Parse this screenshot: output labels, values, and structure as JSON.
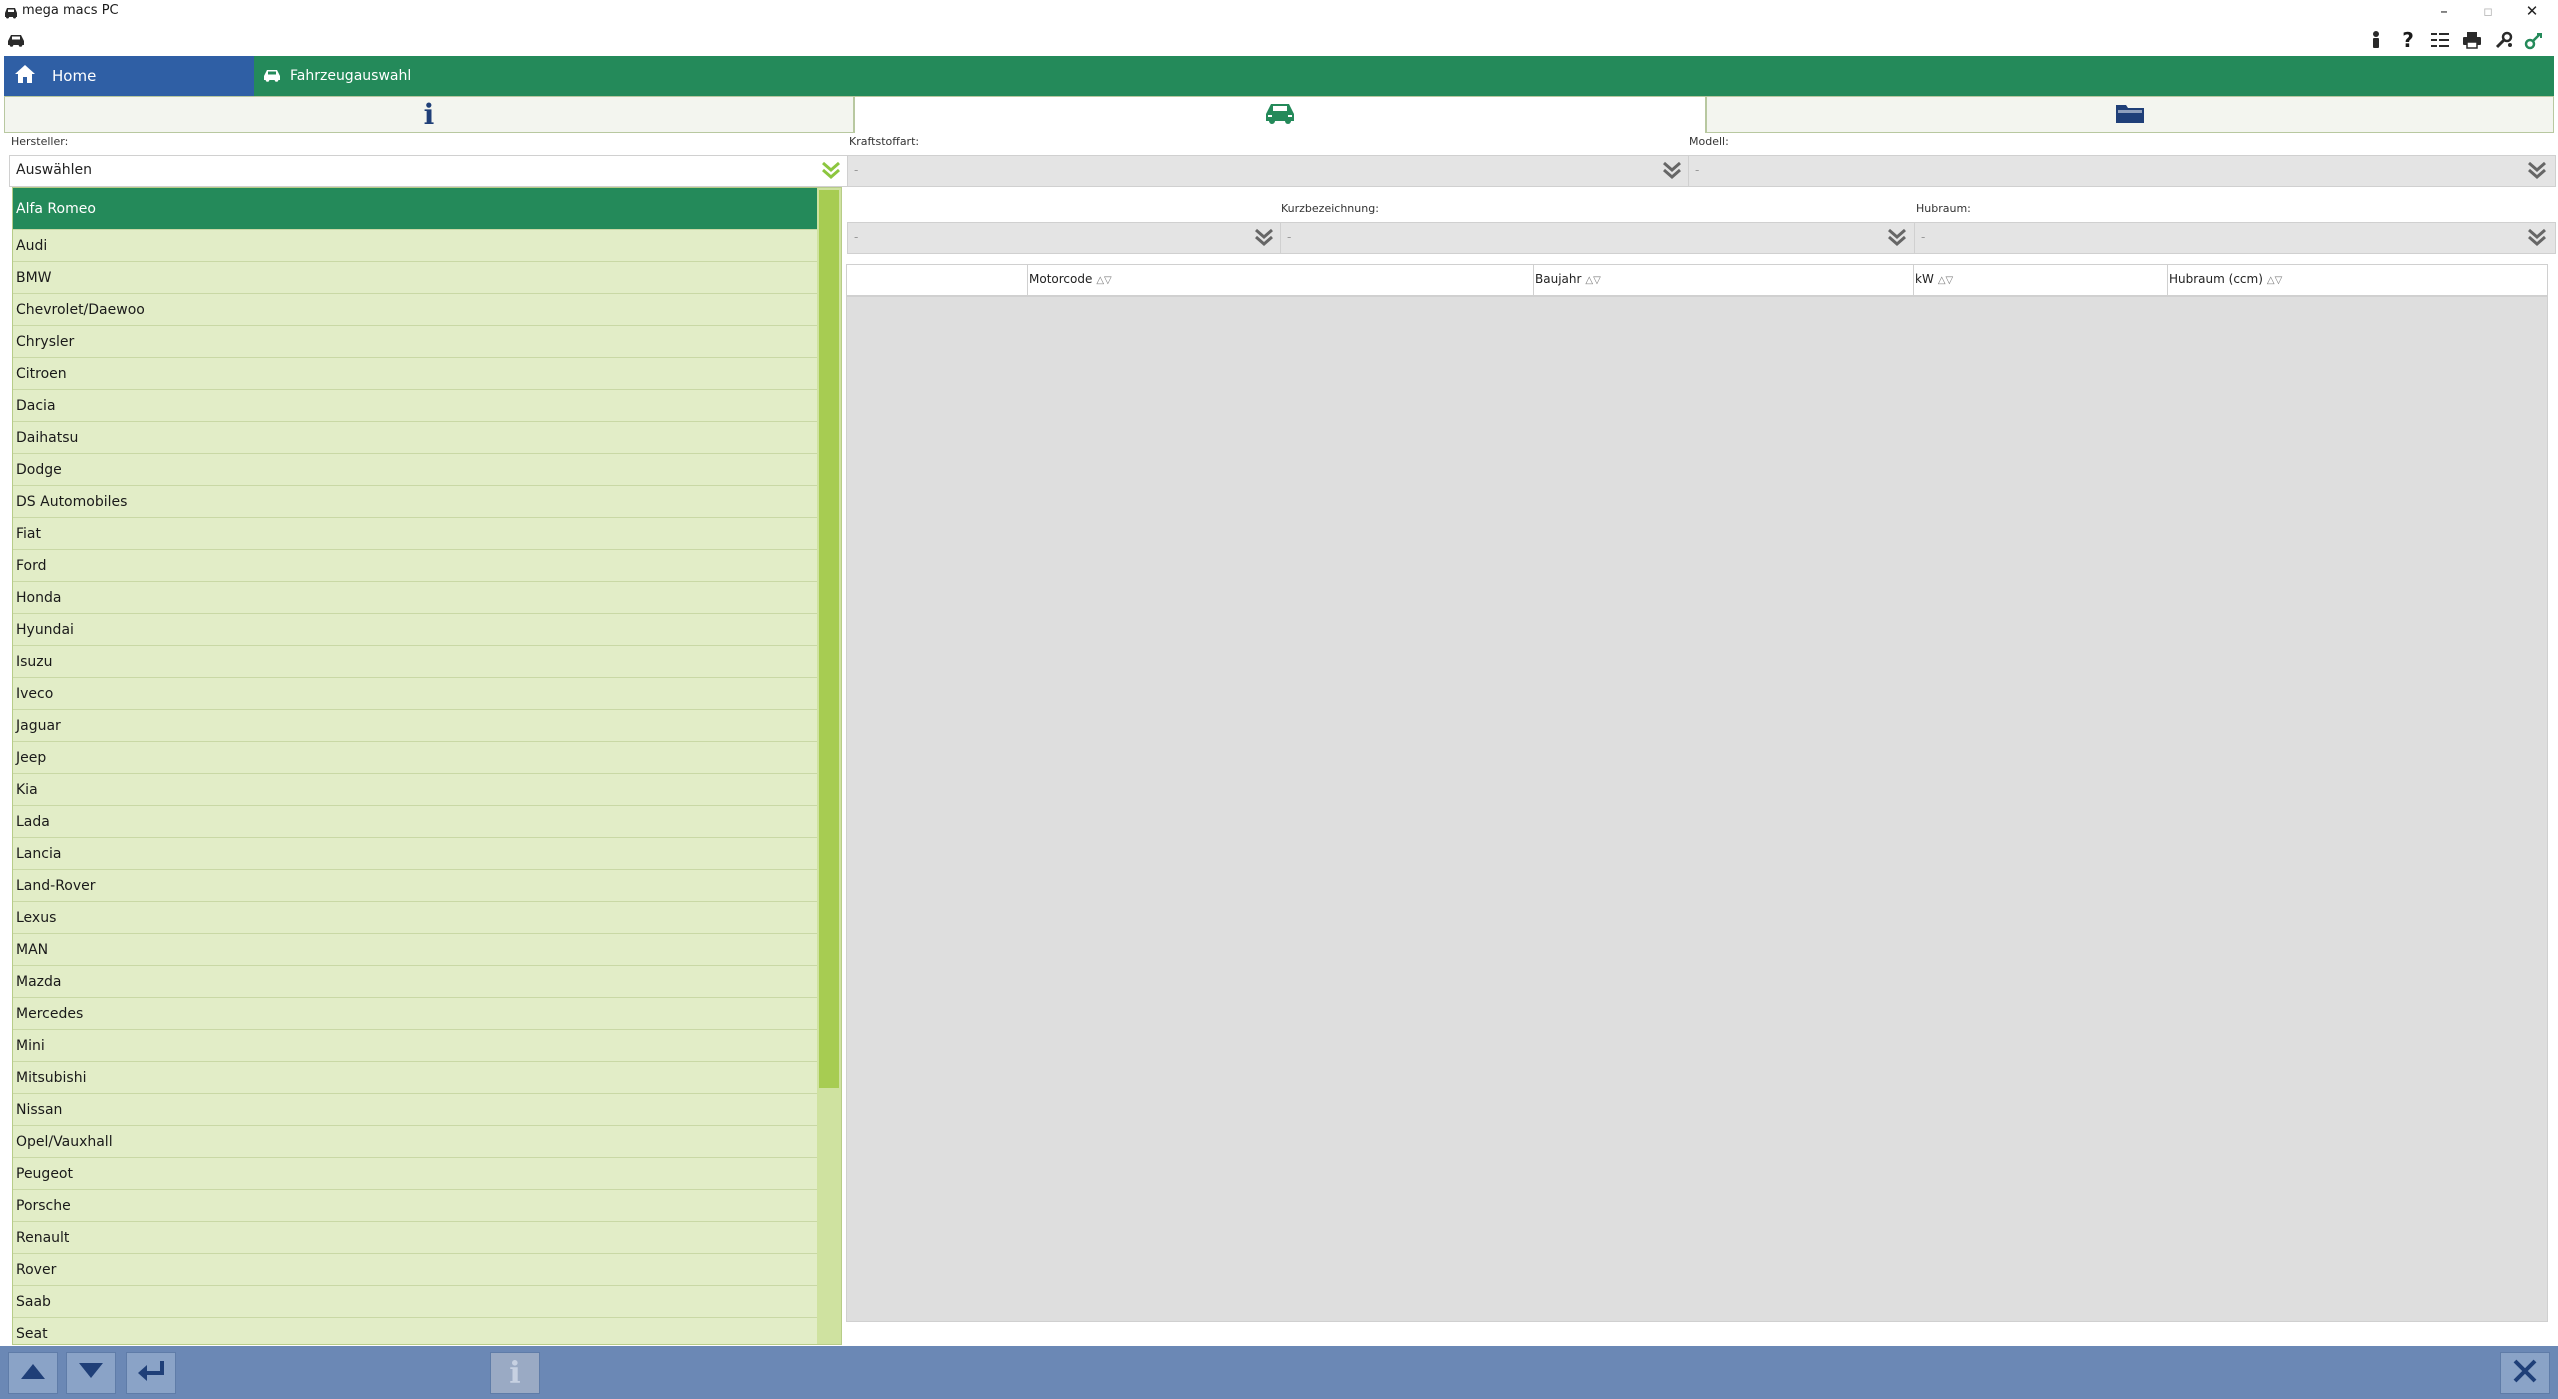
{
  "window": {
    "title": "mega macs PC",
    "controls": [
      "minimize",
      "maximize",
      "close"
    ]
  },
  "toolbar": {
    "icons": [
      "person-icon",
      "help-icon",
      "settings-list-icon",
      "print-icon",
      "tools-icon",
      "connection-icon"
    ]
  },
  "nav": {
    "home_label": "Home",
    "breadcrumb_label": "Fahrzeugauswahl"
  },
  "tabs": [
    {
      "icon": "info-icon",
      "active": false
    },
    {
      "icon": "car-icon",
      "active": true
    },
    {
      "icon": "folder-icon",
      "active": false
    }
  ],
  "filters": {
    "hersteller": {
      "label": "Hersteller:",
      "value": "Auswählen"
    },
    "kraftstoffart": {
      "label": "Kraftstoffart:",
      "value": "-"
    },
    "modell": {
      "label": "Modell:",
      "value": "-"
    },
    "hidden_filter": {
      "value": "-"
    },
    "kurzbezeichnung": {
      "label": "Kurzbezeichnung:",
      "value": "-"
    },
    "hubraum": {
      "label": "Hubraum:",
      "value": "-"
    }
  },
  "table": {
    "columns": [
      "Motorcode",
      "Baujahr",
      "kW",
      "Hubraum (ccm)"
    ],
    "sort_glyph": "△▽"
  },
  "dropdown": {
    "selected": "Alfa Romeo",
    "items": [
      "Audi",
      "BMW",
      "Chevrolet/Daewoo",
      "Chrysler",
      "Citroen",
      "Dacia",
      "Daihatsu",
      "Dodge",
      "DS Automobiles",
      "Fiat",
      "Ford",
      "Honda",
      "Hyundai",
      "Isuzu",
      "Iveco",
      "Jaguar",
      "Jeep",
      "Kia",
      "Lada",
      "Lancia",
      "Land-Rover",
      "Lexus",
      "MAN",
      "Mazda",
      "Mercedes",
      "Mini",
      "Mitsubishi",
      "Nissan",
      "Opel/Vauxhall",
      "Peugeot",
      "Porsche",
      "Renault",
      "Rover",
      "Saab",
      "Seat"
    ]
  },
  "bottom_bar": {
    "buttons": [
      "arrow-up",
      "arrow-down",
      "enter",
      "info",
      "close"
    ]
  },
  "colors": {
    "brand_green": "#248a5a",
    "home_blue": "#2f5fa5",
    "list_bg": "#e2edc7",
    "scroll_thumb": "#a7cc52",
    "bottom_bar": "#6b88b5"
  }
}
